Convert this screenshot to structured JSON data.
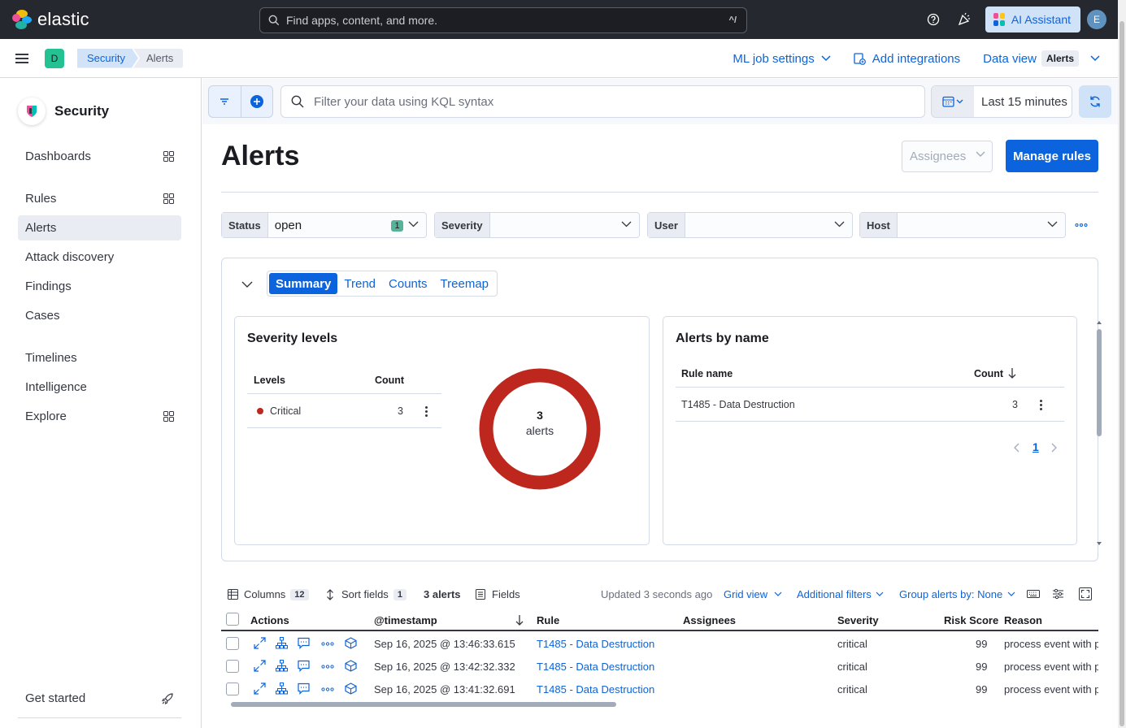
{
  "header": {
    "brand": "elastic",
    "search_placeholder": "Find apps, content, and more.",
    "search_shortcut": "^/",
    "ai_assistant_label": "AI Assistant",
    "user_initial": "E"
  },
  "subheader": {
    "space_initial": "D",
    "breadcrumbs": [
      "Security",
      "Alerts"
    ],
    "ml_job_settings": "ML job settings",
    "add_integrations": "Add integrations",
    "data_view_label": "Data view",
    "data_view_value": "Alerts"
  },
  "sidebar": {
    "title": "Security",
    "items": [
      {
        "label": "Dashboards"
      },
      {
        "label": "Rules"
      },
      {
        "label": "Alerts"
      },
      {
        "label": "Attack discovery"
      },
      {
        "label": "Findings"
      },
      {
        "label": "Cases"
      },
      {
        "label": "Timelines"
      },
      {
        "label": "Intelligence"
      },
      {
        "label": "Explore"
      }
    ],
    "footer_label": "Get started"
  },
  "query": {
    "kql_placeholder": "Filter your data using KQL syntax",
    "time_range": "Last 15 minutes"
  },
  "page": {
    "title": "Alerts",
    "assignees_label": "Assignees",
    "manage_rules_label": "Manage rules"
  },
  "filters": {
    "status": {
      "label": "Status",
      "value": "open",
      "count": "1"
    },
    "severity": {
      "label": "Severity",
      "value": ""
    },
    "user": {
      "label": "User",
      "value": ""
    },
    "host": {
      "label": "Host",
      "value": ""
    }
  },
  "tabs": [
    "Summary",
    "Trend",
    "Counts",
    "Treemap"
  ],
  "severity_card": {
    "title": "Severity levels",
    "col_levels": "Levels",
    "col_count": "Count",
    "rows": [
      {
        "level": "Critical",
        "count": "3",
        "color": "#bd271e"
      }
    ],
    "donut_total": "3",
    "donut_unit": "alerts"
  },
  "alerts_by_name": {
    "title": "Alerts by name",
    "col_rule": "Rule name",
    "col_count": "Count",
    "rows": [
      {
        "rule": "T1485 - Data Destruction",
        "count": "3"
      }
    ],
    "page": "1"
  },
  "grid_toolbar": {
    "columns_label": "Columns",
    "columns_count": "12",
    "sort_label": "Sort fields",
    "sort_count": "1",
    "alerts_count": "3 alerts",
    "fields_label": "Fields",
    "updated": "Updated 3 seconds ago",
    "grid_view": "Grid view",
    "additional_filters": "Additional filters",
    "group_by": "Group alerts by: None"
  },
  "grid": {
    "headers": {
      "actions": "Actions",
      "timestamp": "@timestamp",
      "rule": "Rule",
      "assignees": "Assignees",
      "severity": "Severity",
      "risk": "Risk Score",
      "reason": "Reason"
    },
    "rows": [
      {
        "timestamp": "Sep 16, 2025 @ 13:46:33.615",
        "rule": "T1485 - Data Destruction",
        "assignees": "",
        "severity": "critical",
        "risk": "99",
        "reason": "process event with p"
      },
      {
        "timestamp": "Sep 16, 2025 @ 13:42:32.332",
        "rule": "T1485 - Data Destruction",
        "assignees": "",
        "severity": "critical",
        "risk": "99",
        "reason": "process event with p"
      },
      {
        "timestamp": "Sep 16, 2025 @ 13:41:32.691",
        "rule": "T1485 - Data Destruction",
        "assignees": "",
        "severity": "critical",
        "risk": "99",
        "reason": "process event with p"
      }
    ]
  },
  "colors": {
    "accent": "#0b64dd",
    "critical": "#bd271e",
    "header_bg": "#25282f"
  }
}
